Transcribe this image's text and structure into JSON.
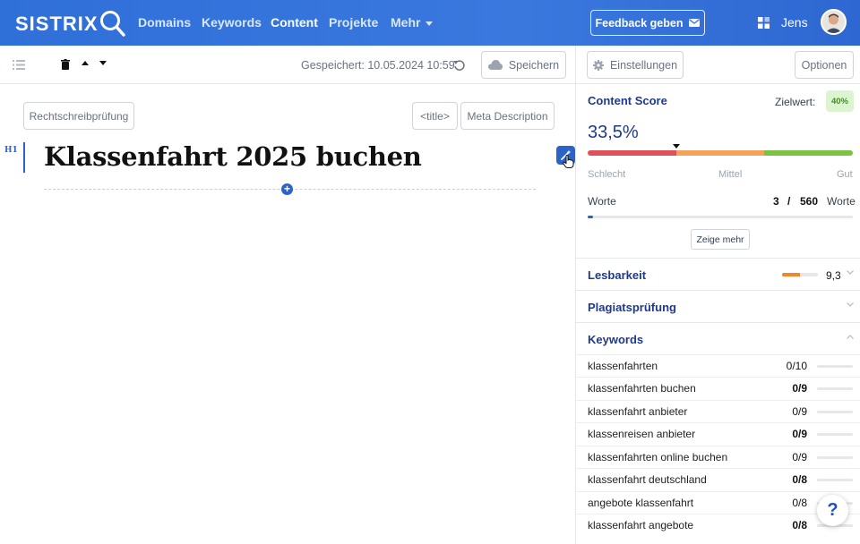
{
  "nav": {
    "logo": "SISTRIX",
    "items": [
      {
        "label": "Domains",
        "active": false
      },
      {
        "label": "Keywords",
        "active": false
      },
      {
        "label": "Content",
        "active": true
      },
      {
        "label": "Projekte",
        "active": false
      },
      {
        "label": "Mehr",
        "active": false
      }
    ],
    "feedback_label": "Feedback geben",
    "user_name": "Jens"
  },
  "toolbar": {
    "saved_text": "Gespeichert: 10.05.2024 10:59",
    "save_label": "Speichern"
  },
  "editor": {
    "spellcheck_label": "Rechtschreibprüfung",
    "title_tag_label": "<title>",
    "meta_label": "Meta Description",
    "heading_tag": "H1",
    "heading_text": "Klassenfahrt 2025 buchen"
  },
  "sidebar": {
    "settings_label": "Einstellungen",
    "options_label": "Optionen",
    "content_score": {
      "title": "Content Score",
      "target_label": "Zielwert:",
      "target_value": "40%",
      "score": "33,5%",
      "score_fraction": 0.335,
      "scale": [
        "Schlecht",
        "Mittel",
        "Gut"
      ],
      "colors": {
        "bad": "#e0505a",
        "mid": "#f3a25a",
        "good": "#7cc242"
      }
    },
    "words": {
      "label": "Worte",
      "current": "3",
      "separator": "/",
      "target": "560",
      "unit": "Worte",
      "fraction": 0.005
    },
    "show_more_label": "Zeige mehr",
    "readability": {
      "title": "Lesbarkeit",
      "value": "9,3",
      "fraction": 0.5
    },
    "plagiarism": {
      "title": "Plagiatsprüfung"
    },
    "keywords": {
      "title": "Keywords",
      "items": [
        {
          "name": "klassenfahrten",
          "count": "0/10"
        },
        {
          "name": "klassenfahrten buchen",
          "count": "0/9"
        },
        {
          "name": "klassenfahrt anbieter",
          "count": "0/9"
        },
        {
          "name": "klassenreisen anbieter",
          "count": "0/9"
        },
        {
          "name": "klassenfahrten online buchen",
          "count": "0/9"
        },
        {
          "name": "klassenfahrt deutschland",
          "count": "0/8"
        },
        {
          "name": "angebote klassenfahrt",
          "count": "0/8"
        },
        {
          "name": "klassenfahrt angebote",
          "count": "0/8"
        }
      ]
    }
  },
  "help_label": "?"
}
